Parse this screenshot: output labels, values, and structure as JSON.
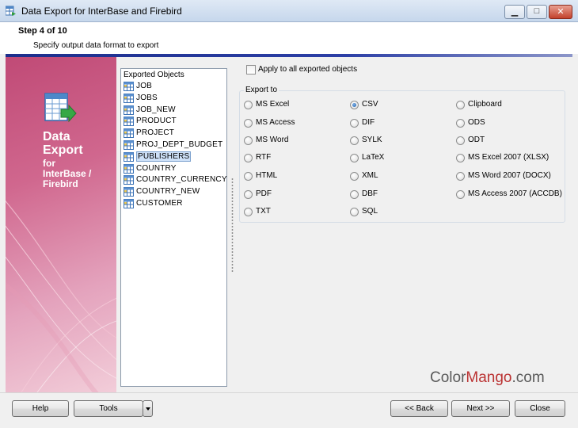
{
  "window": {
    "title": "Data Export for InterBase and Firebird"
  },
  "header": {
    "step_title": "Step 4 of 10",
    "step_description": "Specify output data format to export"
  },
  "branding": {
    "product_line1": "Data",
    "product_line2": "Export",
    "product_sub1": "for",
    "product_sub2": "InterBase /",
    "product_sub3": "Firebird"
  },
  "objects": {
    "caption": "Exported Objects",
    "items": [
      {
        "label": "JOB"
      },
      {
        "label": "JOBS"
      },
      {
        "label": "JOB_NEW"
      },
      {
        "label": "PRODUCT"
      },
      {
        "label": "PROJECT"
      },
      {
        "label": "PROJ_DEPT_BUDGET"
      },
      {
        "label": "PUBLISHERS"
      },
      {
        "label": "COUNTRY"
      },
      {
        "label": "COUNTRY_CURRENCY"
      },
      {
        "label": "COUNTRY_NEW"
      },
      {
        "label": "CUSTOMER"
      }
    ],
    "selected": "PUBLISHERS"
  },
  "options": {
    "apply_all_label": "Apply to all exported objects",
    "apply_all_checked": false,
    "export_to_caption": "Export to",
    "formats": {
      "ms_excel": "MS Excel",
      "ms_access": "MS Access",
      "ms_word": "MS Word",
      "rtf": "RTF",
      "html": "HTML",
      "pdf": "PDF",
      "txt": "TXT",
      "csv": "CSV",
      "dif": "DIF",
      "sylk": "SYLK",
      "latex": "LaTeX",
      "xml": "XML",
      "dbf": "DBF",
      "sql": "SQL",
      "clipboard": "Clipboard",
      "ods": "ODS",
      "odt": "ODT",
      "xlsx": "MS Excel 2007 (XLSX)",
      "docx": "MS Word 2007 (DOCX)",
      "accdb": "MS Access 2007 (ACCDB)"
    },
    "selected_format": "CSV"
  },
  "watermark": {
    "part1": "Color",
    "part2": "Mango",
    "part3": ".com"
  },
  "buttons": {
    "help": "Help",
    "tools": "Tools",
    "back": "<< Back",
    "next": "Next >>",
    "close": "Close"
  },
  "colors": {
    "header_bar": "#1c2f8c",
    "art_panel": "#c04a76",
    "selection": "#cde0f7"
  }
}
